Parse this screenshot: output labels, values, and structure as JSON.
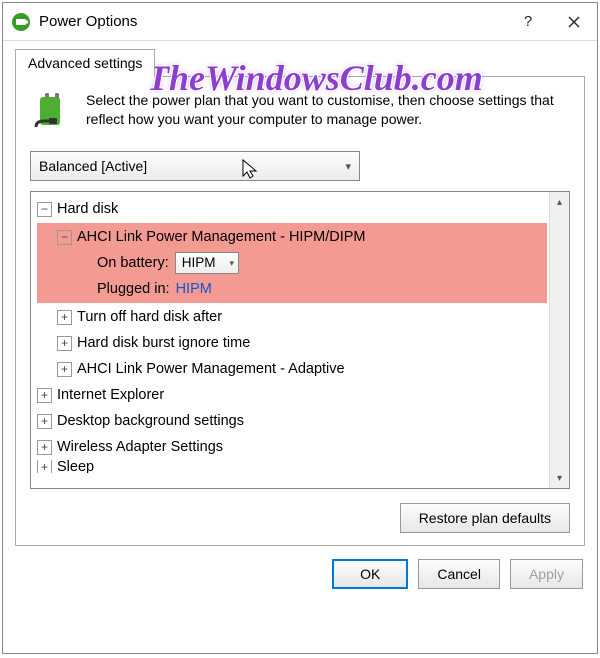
{
  "titlebar": {
    "title": "Power Options"
  },
  "tab": {
    "label": "Advanced settings"
  },
  "instructions": "Select the power plan that you want to customise, then choose settings that reflect how you want your computer to manage power.",
  "plan_selected": "Balanced [Active]",
  "tree": {
    "hard_disk": "Hard disk",
    "ahci_hipm_dipm": "AHCI Link Power Management - HIPM/DIPM",
    "on_battery_label": "On battery:",
    "on_battery_value": "HIPM",
    "plugged_in_label": "Plugged in:",
    "plugged_in_value": "HIPM",
    "turn_off_hd": "Turn off hard disk after",
    "hd_burst": "Hard disk burst ignore time",
    "ahci_adaptive": "AHCI Link Power Management - Adaptive",
    "ie": "Internet Explorer",
    "desktop_bg": "Desktop background settings",
    "wireless": "Wireless Adapter Settings",
    "sleep": "Sleep"
  },
  "buttons": {
    "restore": "Restore plan defaults",
    "ok": "OK",
    "cancel": "Cancel",
    "apply": "Apply"
  },
  "watermark": "TheWindowsClub.com"
}
